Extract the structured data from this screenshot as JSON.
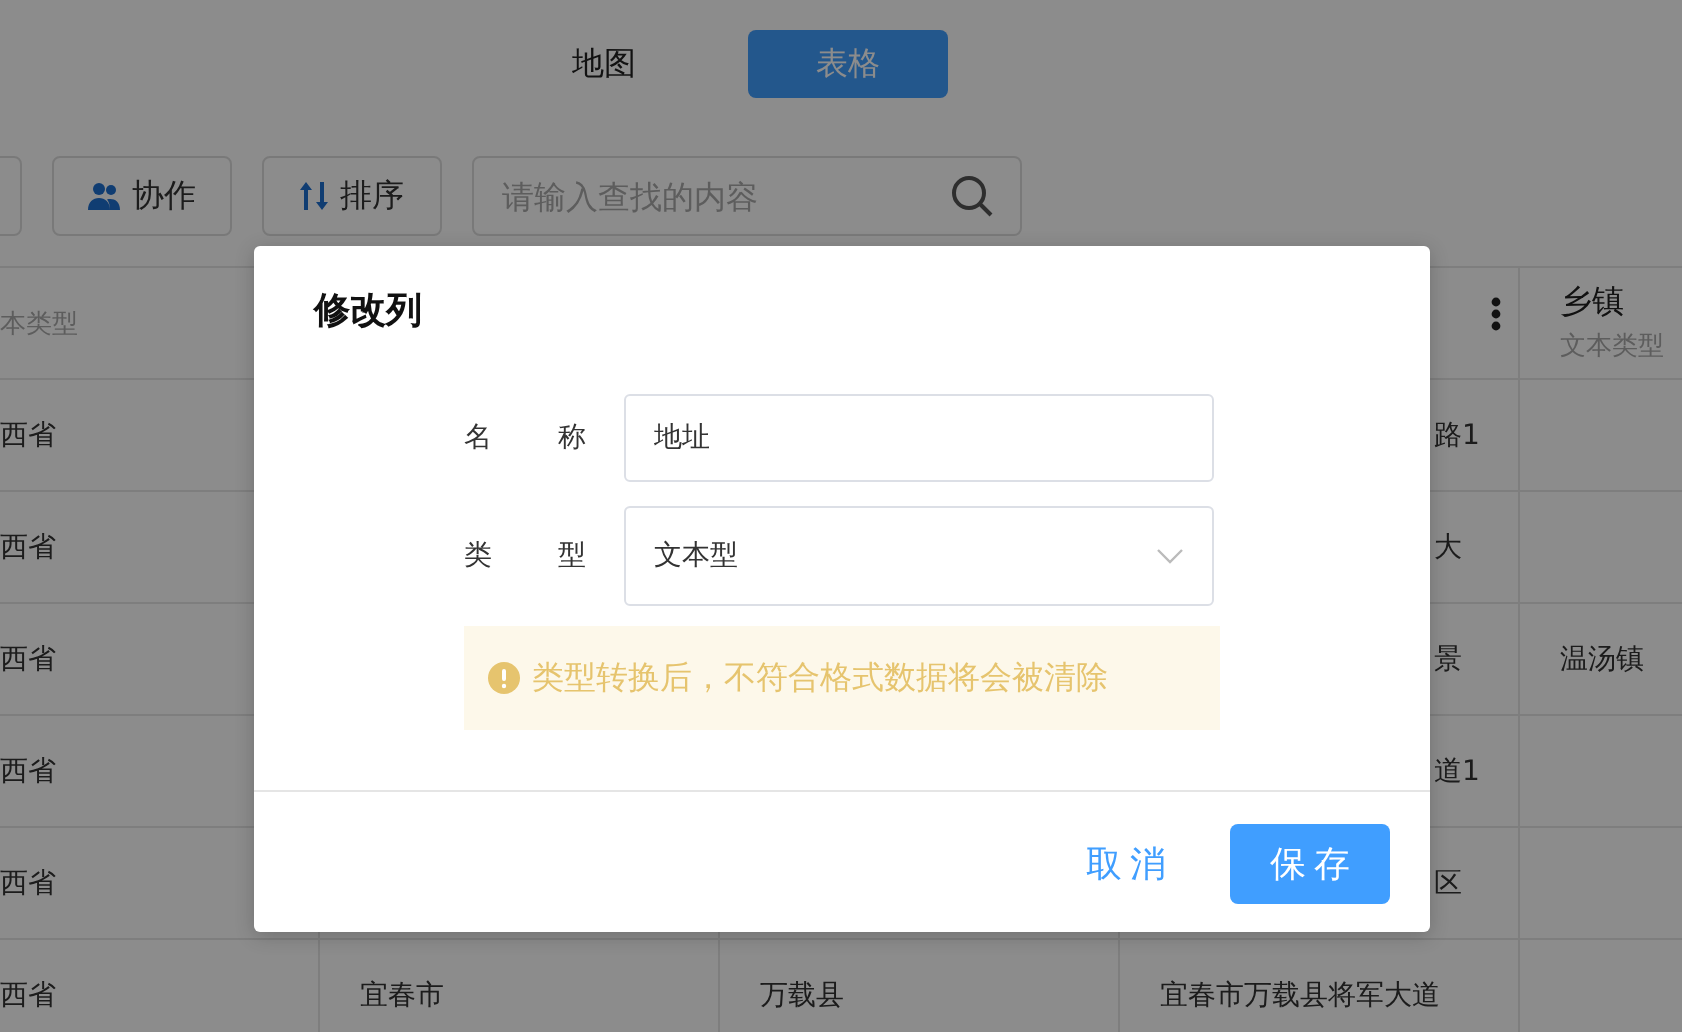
{
  "top_tabs": [
    {
      "label": "地图",
      "selected": false
    },
    {
      "label": "表格",
      "selected": true
    }
  ],
  "toolbar": {
    "buttons": [
      {
        "kind": "people",
        "label": "协作"
      },
      {
        "kind": "sort",
        "label": "排序"
      }
    ],
    "search": {
      "placeholder": "请输入查找的内容"
    }
  },
  "table": {
    "columns": [
      {
        "subtitle": "本类型"
      },
      {},
      {},
      {
        "has_menu": true
      },
      {
        "title": "乡镇",
        "subtitle": "文本类型"
      }
    ],
    "rows": [
      {
        "cells": [
          "西省",
          null,
          null,
          "路1",
          null
        ]
      },
      {
        "cells": [
          "西省",
          null,
          null,
          "大",
          null
        ]
      },
      {
        "cells": [
          "西省",
          null,
          null,
          "景",
          "温汤镇"
        ]
      },
      {
        "cells": [
          "西省",
          null,
          null,
          "道1",
          null
        ]
      },
      {
        "cells": [
          "西省",
          null,
          null,
          "区",
          null
        ]
      },
      {
        "cells": [
          "西省",
          "宜春市",
          "万载县",
          "宜春市万载县将军大道",
          null
        ]
      }
    ]
  },
  "dialog": {
    "title": "修改列",
    "fields": [
      {
        "kind": "text",
        "label": "名称",
        "value": "地址"
      },
      {
        "kind": "select",
        "label": "类型",
        "value": "文本型"
      }
    ],
    "warning": "类型转换后，不符合格式数据将会被清除",
    "buttons": [
      {
        "kind": "text",
        "label": "取消"
      },
      {
        "kind": "primary",
        "label": "保存"
      }
    ]
  }
}
